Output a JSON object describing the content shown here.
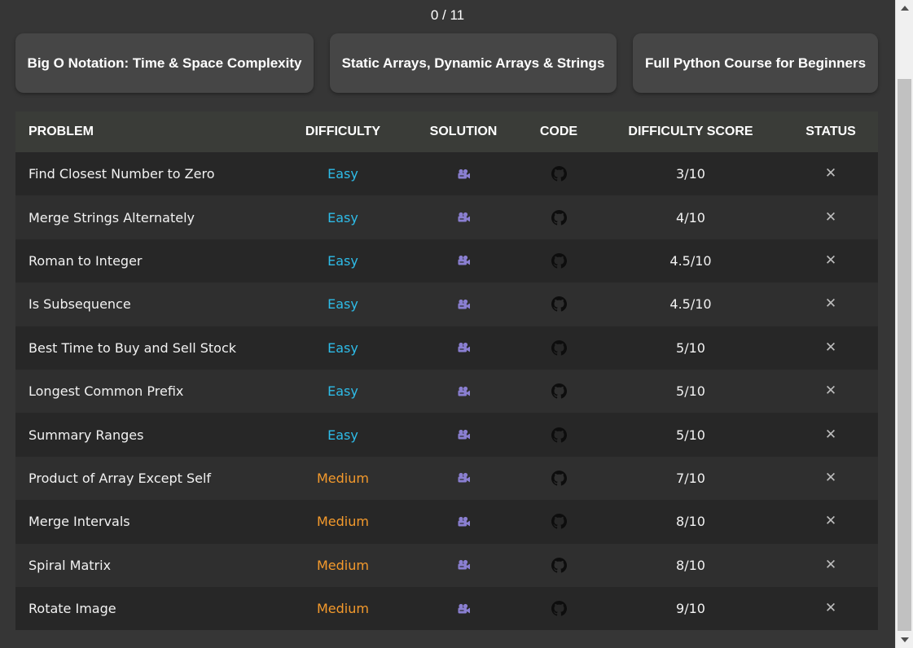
{
  "progress": "0 / 11",
  "courses": [
    {
      "label": "Big O Notation: Time & Space Complexity"
    },
    {
      "label": "Static Arrays, Dynamic Arrays & Strings"
    },
    {
      "label": "Full Python Course for Beginners"
    }
  ],
  "table": {
    "headers": {
      "problem": "PROBLEM",
      "difficulty": "DIFFICULTY",
      "solution": "SOLUTION",
      "code": "CODE",
      "score": "DIFFICULTY SCORE",
      "status": "STATUS"
    },
    "rows": [
      {
        "problem": "Find Closest Number to Zero",
        "difficulty": "Easy",
        "score": "3/10",
        "solution_icon": "video-camera-icon",
        "code_icon": "github-icon",
        "status_icon": "x-mark-icon"
      },
      {
        "problem": "Merge Strings Alternately",
        "difficulty": "Easy",
        "score": "4/10",
        "solution_icon": "video-camera-icon",
        "code_icon": "github-icon",
        "status_icon": "x-mark-icon"
      },
      {
        "problem": "Roman to Integer",
        "difficulty": "Easy",
        "score": "4.5/10",
        "solution_icon": "video-camera-icon",
        "code_icon": "github-icon",
        "status_icon": "x-mark-icon"
      },
      {
        "problem": "Is Subsequence",
        "difficulty": "Easy",
        "score": "4.5/10",
        "solution_icon": "video-camera-icon",
        "code_icon": "github-icon",
        "status_icon": "x-mark-icon"
      },
      {
        "problem": "Best Time to Buy and Sell Stock",
        "difficulty": "Easy",
        "score": "5/10",
        "solution_icon": "video-camera-icon",
        "code_icon": "github-icon",
        "status_icon": "x-mark-icon"
      },
      {
        "problem": "Longest Common Prefix",
        "difficulty": "Easy",
        "score": "5/10",
        "solution_icon": "video-camera-icon",
        "code_icon": "github-icon",
        "status_icon": "x-mark-icon"
      },
      {
        "problem": "Summary Ranges",
        "difficulty": "Easy",
        "score": "5/10",
        "solution_icon": "video-camera-icon",
        "code_icon": "github-icon",
        "status_icon": "x-mark-icon"
      },
      {
        "problem": "Product of Array Except Self",
        "difficulty": "Medium",
        "score": "7/10",
        "solution_icon": "video-camera-icon",
        "code_icon": "github-icon",
        "status_icon": "x-mark-icon"
      },
      {
        "problem": "Merge Intervals",
        "difficulty": "Medium",
        "score": "8/10",
        "solution_icon": "video-camera-icon",
        "code_icon": "github-icon",
        "status_icon": "x-mark-icon"
      },
      {
        "problem": "Spiral Matrix",
        "difficulty": "Medium",
        "score": "8/10",
        "solution_icon": "video-camera-icon",
        "code_icon": "github-icon",
        "status_icon": "x-mark-icon"
      },
      {
        "problem": "Rotate Image",
        "difficulty": "Medium",
        "score": "9/10",
        "solution_icon": "video-camera-icon",
        "code_icon": "github-icon",
        "status_icon": "x-mark-icon"
      }
    ]
  },
  "status_mark": "✕",
  "colors": {
    "easy": "#2ebce8",
    "medium": "#f49a2c",
    "background": "#363636",
    "solution_icon": "#8a7fd1"
  }
}
